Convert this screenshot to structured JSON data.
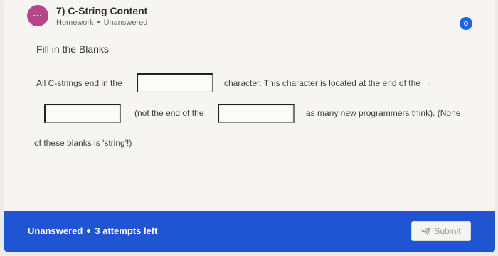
{
  "question": {
    "badge": "...",
    "title": "7) C-String Content",
    "type": "Homework",
    "status": "Unanswered",
    "status_dot_color": "#1d63e0"
  },
  "section": {
    "title": "Fill in the Blanks"
  },
  "prompt": {
    "part1": "All C-strings end in the",
    "part2": "character. This character is located at the end of the",
    "part3": "(not the end of the",
    "part4": "as many new programmers think). (None",
    "part5": "of these blanks is 'string'!)"
  },
  "blanks": [
    {
      "value": ""
    },
    {
      "value": ""
    },
    {
      "value": ""
    }
  ],
  "footer": {
    "status": "Unanswered",
    "attempts": "3 attempts left",
    "submit_label": "Submit",
    "accent": "#1f55d2"
  }
}
